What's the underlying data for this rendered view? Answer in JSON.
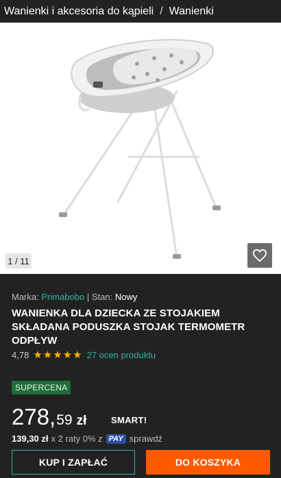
{
  "breadcrumb": {
    "items": [
      "Wanienki i akcesoria do kąpieli",
      "Wanienki"
    ],
    "separator": "/"
  },
  "gallery": {
    "counter": "1 / 11",
    "favorite_icon": "heart-icon"
  },
  "product": {
    "brand_label": "Marka:",
    "brand": "Primabobo",
    "condition_label": "| Stan:",
    "condition": "Nowy",
    "title": "WANIENKA DLA DZIECKA ZE STOJAKIEM SKŁADANA PODUSZKA STOJAK TERMOMETR ODPŁYW",
    "rating_score": "4,78",
    "rating_stars": 5,
    "rating_count": "27 ocen produktu"
  },
  "pricing": {
    "badge": "SUPERCENA",
    "price_int": "278,",
    "price_dec": "59",
    "currency": "zł",
    "smart_label": "SMART!",
    "installment_amount": "139,30 zł",
    "installment_text": "x 2 raty 0% z",
    "pay_label": "PAY",
    "check_label": "sprawdź"
  },
  "actions": {
    "buy_now": "KUP I ZAPŁAĆ",
    "add_to_cart": "DO KOSZYKA"
  },
  "colors": {
    "background": "#222222",
    "accent_teal": "#2fb5a4",
    "cta_orange": "#ff5a00",
    "badge_green": "#1f6d3b",
    "star": "#f4b400"
  }
}
